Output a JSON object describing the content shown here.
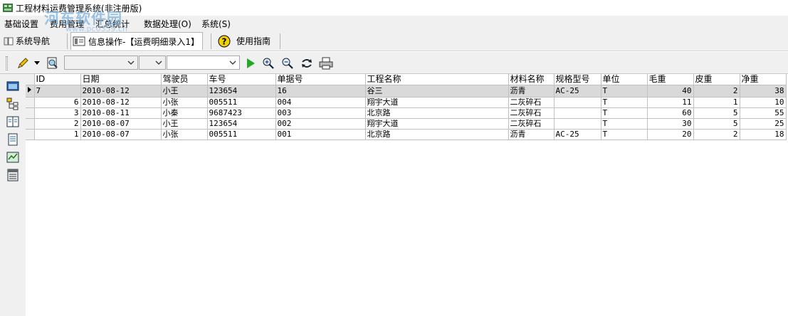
{
  "window": {
    "title": "工程材料运费管理系统(非注册版)"
  },
  "watermark": {
    "text": "河东软件园",
    "url": "www.pc0359.cn"
  },
  "menu": {
    "items": [
      {
        "label": "基础设置"
      },
      {
        "label": "费用管理"
      },
      {
        "label": "汇总统计"
      },
      {
        "label": "数据处理(O)"
      },
      {
        "label": "系统(S)"
      }
    ]
  },
  "tabs": {
    "nav": "系统导航",
    "info": "信息操作-【运费明细录入1】",
    "guide": "使用指南"
  },
  "toolbar": {
    "combo1": "",
    "combo2": "",
    "combo3": ""
  },
  "table": {
    "columns": [
      "ID",
      "日期",
      "驾驶员",
      "车号",
      "单据号",
      "工程名称",
      "材料名称",
      "规格型号",
      "单位",
      "毛重",
      "皮重",
      "净重"
    ],
    "rows": [
      {
        "id": "7",
        "date": "2010-08-12",
        "driver": "小王",
        "car": "123654",
        "doc": "16",
        "project": "谷三",
        "material": "沥青",
        "spec": "AC-25",
        "unit": "T",
        "gross": "40",
        "tare": "2",
        "net": "38"
      },
      {
        "id": "6",
        "date": "2010-08-12",
        "driver": "小张",
        "car": "005511",
        "doc": "004",
        "project": "翔宇大道",
        "material": "二灰碎石",
        "spec": "",
        "unit": "T",
        "gross": "11",
        "tare": "1",
        "net": "10"
      },
      {
        "id": "3",
        "date": "2010-08-11",
        "driver": "小秦",
        "car": "9687423",
        "doc": "003",
        "project": "北京路",
        "material": "二灰碎石",
        "spec": "",
        "unit": "T",
        "gross": "60",
        "tare": "5",
        "net": "55"
      },
      {
        "id": "2",
        "date": "2010-08-07",
        "driver": "小王",
        "car": "123654",
        "doc": "002",
        "project": "翔宇大道",
        "material": "二灰碎石",
        "spec": "",
        "unit": "T",
        "gross": "30",
        "tare": "5",
        "net": "25"
      },
      {
        "id": "1",
        "date": "2010-08-07",
        "driver": "小张",
        "car": "005511",
        "doc": "001",
        "project": "北京路",
        "material": "沥青",
        "spec": "AC-25",
        "unit": "T",
        "gross": "20",
        "tare": "2",
        "net": "18"
      }
    ]
  },
  "colors": {
    "selected_row": "#d9d9d9",
    "chrome": "#f0f0f0",
    "grid_line": "#c0c0c0",
    "play": "#22aa22"
  }
}
